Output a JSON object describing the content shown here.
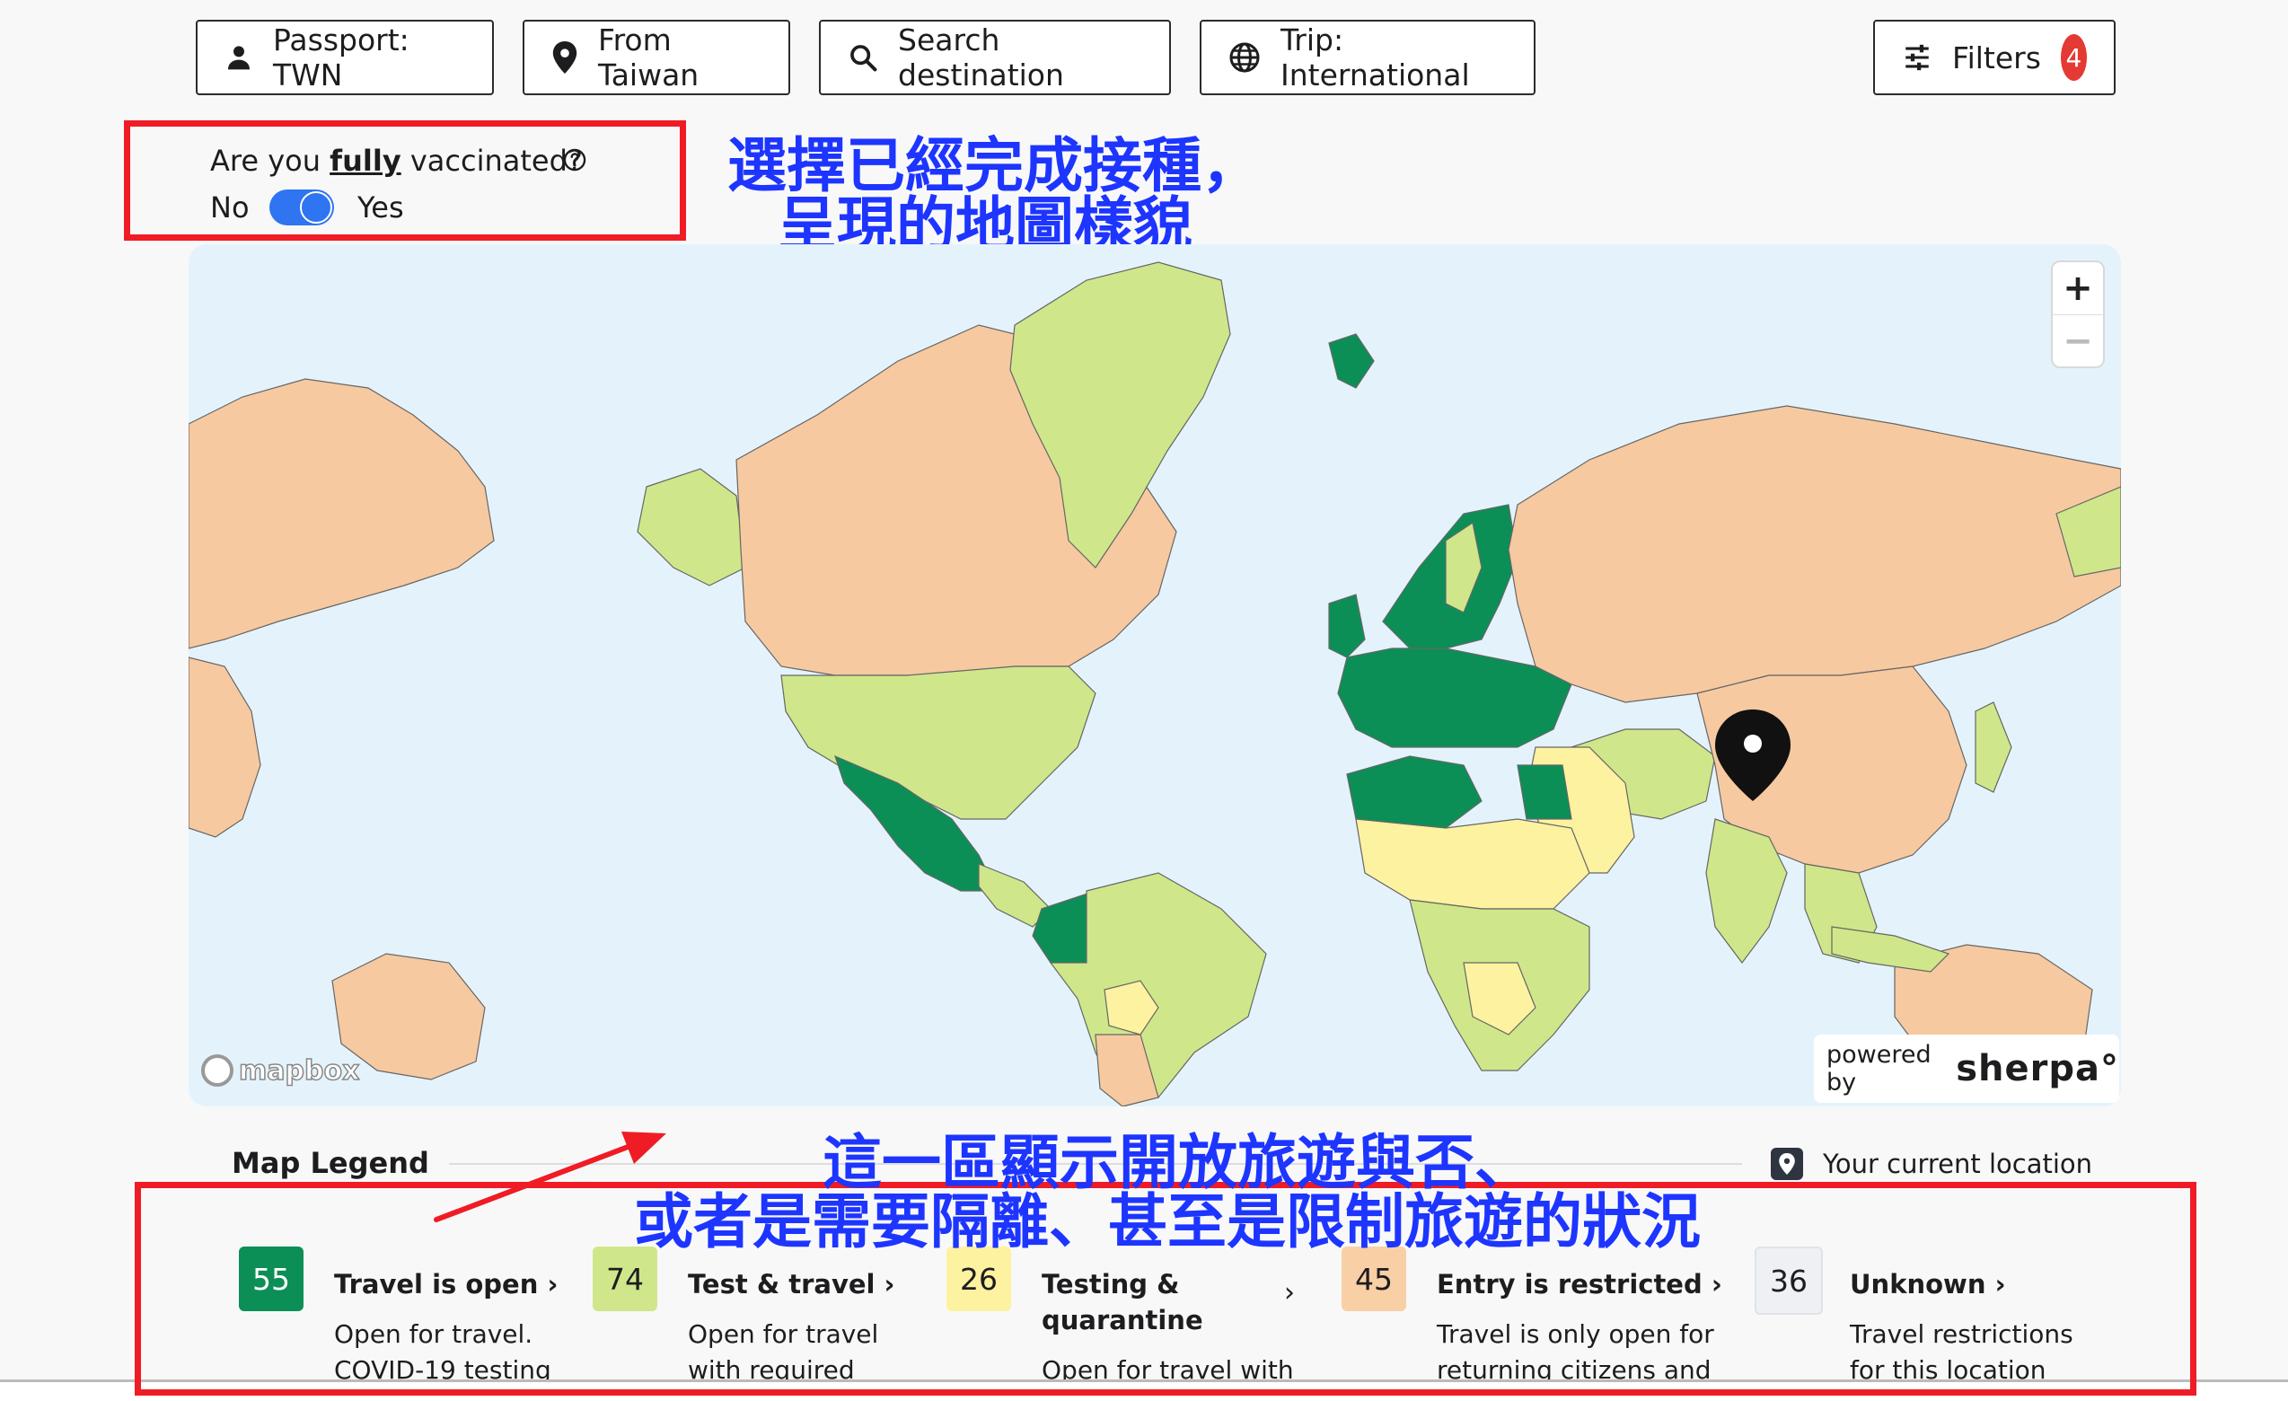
{
  "toolbar": {
    "passport_label": "Passport: TWN",
    "from_label": "From Taiwan",
    "search_label": "Search destination",
    "trip_label": "Trip: International",
    "filters_label": "Filters",
    "filters_count": "4"
  },
  "vaccination": {
    "question_prefix": "Are you ",
    "question_emph": "fully",
    "question_suffix": " vaccinated?",
    "no_label": "No",
    "yes_label": "Yes"
  },
  "annotations": {
    "top_line1": "選擇已經完成接種，",
    "top_line2": "呈現的地圖樣貌",
    "bottom_line1": "這一區顯示開放旅遊與否、",
    "bottom_line2": "或者是需要隔離、甚至是限制旅遊的狀況"
  },
  "map": {
    "zoom_in": "+",
    "zoom_out": "−",
    "powered_by": "powered by",
    "brand": "sherpa°",
    "mapbox": "mapbox"
  },
  "legend": {
    "title": "Map Legend",
    "current_location": "Your current location",
    "items": [
      {
        "count": "55",
        "title": "Travel is open ›",
        "desc1": "Open for travel.",
        "desc2": "COVID-19 testing",
        "color": "#0b8f57",
        "text_color": "#ffffff"
      },
      {
        "count": "74",
        "title": "Test & travel ›",
        "desc1": "Open for travel",
        "desc2": "with required",
        "color": "#cfe78a",
        "text_color": "#1d1d1f"
      },
      {
        "count": "26",
        "title": "Testing &",
        "title2": "quarantine",
        "chev": "›",
        "desc1": "Open for travel with",
        "color": "#fdf2a0",
        "text_color": "#1d1d1f"
      },
      {
        "count": "45",
        "title": "Entry is restricted ›",
        "desc1": "Travel is only open for",
        "desc2": "returning citizens and",
        "color": "#f9cfa6",
        "text_color": "#1d1d1f"
      },
      {
        "count": "36",
        "title": "Unknown ›",
        "desc1": "Travel restrictions",
        "desc2": "for this location",
        "color": "#eef0f3",
        "text_color": "#1d1d1f"
      }
    ]
  },
  "colors": {
    "open": "#0b8f57",
    "test": "#cfe78a",
    "quarantine": "#fdf2a0",
    "restricted": "#f7c9a0",
    "unknown": "#eef0f3",
    "water": "#e4f3fb",
    "annotation": "#1d35ff",
    "highlight": "#ef1c25"
  }
}
